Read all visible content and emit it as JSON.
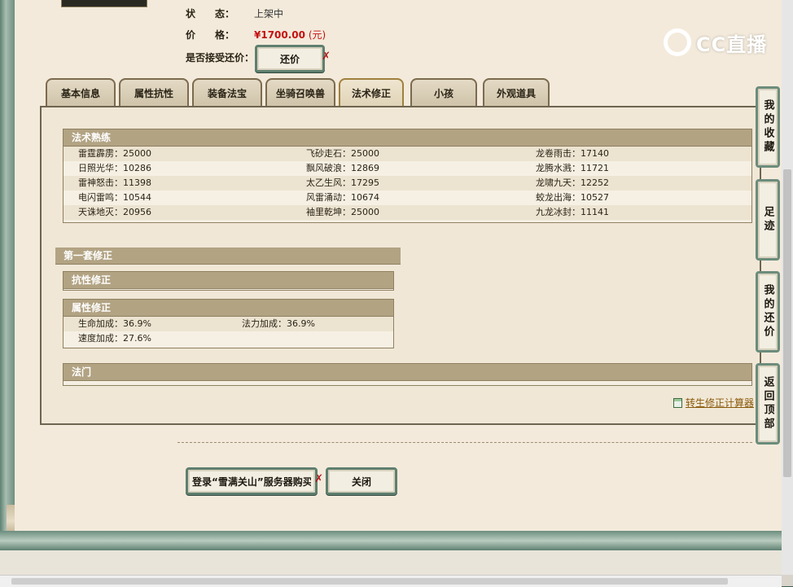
{
  "status": {
    "label": "状　　态：",
    "value": "上架中"
  },
  "price": {
    "label": "价　　格：",
    "value": "¥1700.00",
    "unit": "(元)"
  },
  "bargain": {
    "label": "是否接受还价：",
    "button": "还价"
  },
  "logo": {
    "text": "CC直播"
  },
  "tabs": [
    "基本信息",
    "属性抗性",
    "装备法宝",
    "坐骑召唤兽",
    "法术修正",
    "小孩",
    "外观道具"
  ],
  "active_tab": "法术修正",
  "skills": {
    "title": "法术熟练",
    "rows": [
      [
        "雷霆霹雳：25000",
        "飞砂走石：25000",
        "龙卷雨击：17140"
      ],
      [
        "日照光华：10286",
        "飘风破浪：12869",
        "龙腾水溅：11721"
      ],
      [
        "雷神怒击：11398",
        "太乙生风：17295",
        "龙啸九天：12252"
      ],
      [
        "电闪雷鸣：10544",
        "风雷涌动：10674",
        "蛟龙出海：10527"
      ],
      [
        "天诛地灭：20956",
        "袖里乾坤：25000",
        "九龙冰封：11141"
      ]
    ]
  },
  "set1": {
    "title": "第一套修正"
  },
  "resist": {
    "title": "抗性修正"
  },
  "attr": {
    "title": "属性修正",
    "rows": [
      [
        "生命加成：36.9%",
        "法力加成：36.9%"
      ],
      [
        "速度加成：27.6%",
        ""
      ]
    ]
  },
  "school": {
    "title": "法门"
  },
  "calc_link": "转生修正计算器",
  "actions": {
    "login": "登录“雪满关山”服务器购买",
    "close": "关闭"
  },
  "side": {
    "fav": "我的收藏",
    "footprint": "足迹",
    "my_bargain": "我的还价",
    "top": "返回顶部"
  },
  "colors": {
    "accent_red": "#c41010",
    "frame_green": "#5f7f6f",
    "header_tan": "#b2a383"
  }
}
